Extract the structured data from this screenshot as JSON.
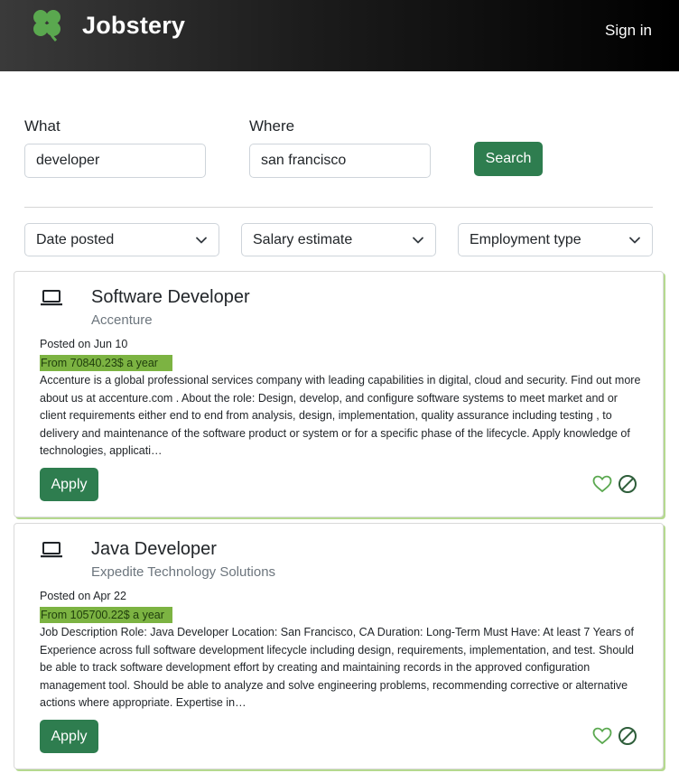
{
  "header": {
    "brand": "Jobstery",
    "logo_icon": "clover-icon",
    "signin_label": "Sign in"
  },
  "search": {
    "what_label": "What",
    "what_value": "developer",
    "where_label": "Where",
    "where_value": "san francisco",
    "button_label": "Search"
  },
  "filters": [
    {
      "label": "Date posted",
      "icon": "chevron-down-icon"
    },
    {
      "label": "Salary estimate",
      "icon": "chevron-down-icon"
    },
    {
      "label": "Employment type",
      "icon": "chevron-down-icon"
    }
  ],
  "jobs": [
    {
      "icon": "laptop-icon",
      "title": "Software Developer",
      "company": "Accenture",
      "posted": "Posted on Jun 10",
      "salary": "From 70840.23$ a year",
      "description": "Accenture is a global professional services company with leading capabilities in digital, cloud and security. Find out more about us at accenture.com . About the role: Design, develop, and configure software systems to meet market and or client requirements either end to end from analysis, design, implementation, quality assurance including testing , to delivery and maintenance of the software product or system or for a specific phase of the lifecycle. Apply knowledge of technologies, applicati…",
      "apply_label": "Apply"
    },
    {
      "icon": "laptop-icon",
      "title": "Java Developer",
      "company": "Expedite Technology Solutions",
      "posted": "Posted on Apr 22",
      "salary": "From 105700.22$ a year",
      "description": "Job Description Role: Java Developer Location: San Francisco, CA Duration: Long-Term Must Have: At least 7 Years of Experience across full software development lifecycle including design, requirements, implementation, and test. Should be able to track software development effort by creating and maintaining records in the approved configuration management tool. Should be able to analyze and solve engineering problems, recommending corrective or alternative actions where appropriate. Expertise in…",
      "apply_label": "Apply"
    }
  ],
  "colors": {
    "accent_green": "#2e7d4f",
    "salary_highlight": "#7cb342",
    "card_shadow": "#b5d98f",
    "header_dark": "#000000"
  }
}
